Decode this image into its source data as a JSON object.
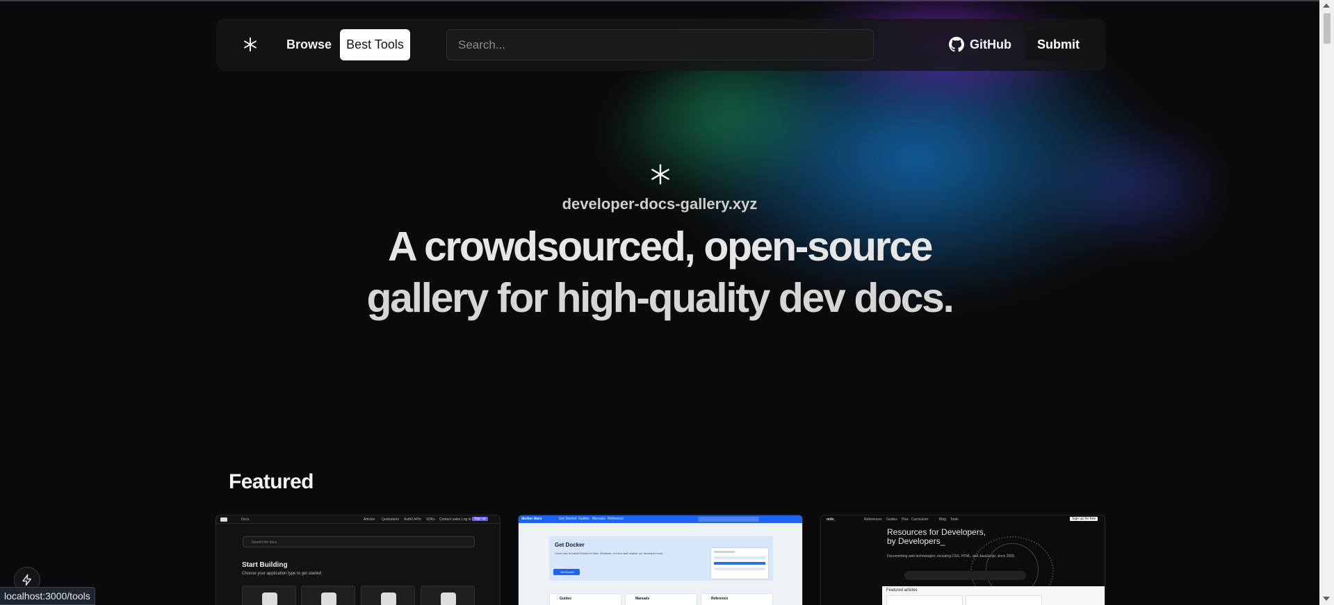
{
  "nav": {
    "logo_icon": "asterisk-icon",
    "browse_label": "Browse",
    "best_tools_label": "Best Tools",
    "search_placeholder": "Search...",
    "github_label": "GitHub",
    "github_icon": "github-icon",
    "submit_label": "Submit"
  },
  "hero": {
    "icon": "asterisk-icon",
    "site_name": "developer-docs-gallery.xyz",
    "headline_line1": "A crowdsourced, open-source",
    "headline_line2": "gallery for high-quality dev docs."
  },
  "featured": {
    "title": "Featured",
    "cards": [
      {
        "logo_text": "Docs",
        "nav_items": [
          "Articles",
          "Quickstarts",
          "Auth0 APIs",
          "SDKs",
          "Contact sales",
          "Log in",
          "Sign up"
        ],
        "search_placeholder": "Search the docs",
        "heading": "Start Building",
        "subheading": "Choose your application type to get started"
      },
      {
        "logo_text": "docker docs",
        "nav_items": [
          "Get Started",
          "Guides",
          "Manuals",
          "Reference"
        ],
        "heading": "Get Docker",
        "description": "Learn how to install Docker for Mac, Windows, or Linux and explore our developer tools.",
        "button_label": "Get Docker",
        "boxes": [
          "Guides",
          "Manuals",
          "Reference"
        ]
      },
      {
        "logo_text": "mdn_",
        "nav_items": [
          "References",
          "Guides",
          "Plus",
          "Curriculum",
          "Blog",
          "Tools"
        ],
        "signup_label": "Sign up for free",
        "heading_line1": "Resources for Developers,",
        "heading_line2": "by Developers_",
        "description": "Documenting web technologies, including CSS, HTML, and JavaScript, since 2005.",
        "section_title": "Featured articles"
      }
    ]
  },
  "status_bar": {
    "url": "localhost:3000/tools"
  },
  "floating_button_icon": "lightning-icon",
  "colors": {
    "background": "#0a0a0a",
    "accent_blue": "#126eb9",
    "accent_purple": "#7828c8",
    "accent_green": "#188c5a"
  }
}
